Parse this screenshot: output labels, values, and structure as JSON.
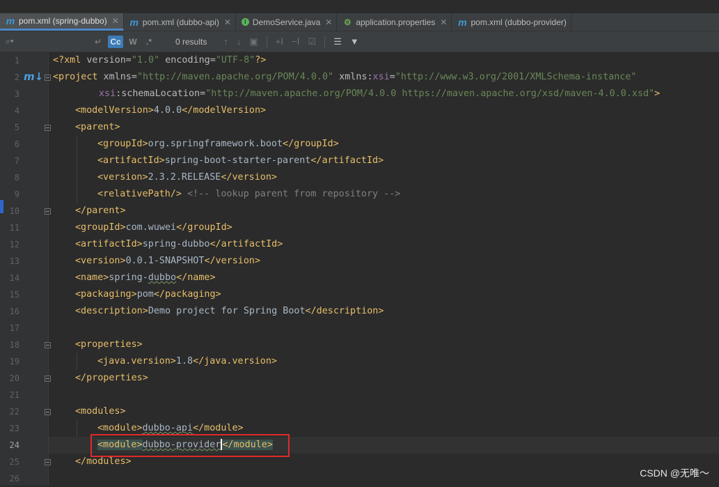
{
  "tabs": [
    {
      "label": "pom.xml (spring-dubbo)",
      "icon": "maven-icon",
      "active": true
    },
    {
      "label": "pom.xml (dubbo-api)",
      "icon": "maven-icon",
      "active": false
    },
    {
      "label": "DemoService.java",
      "icon": "java-interface-icon",
      "active": false
    },
    {
      "label": "application.properties",
      "icon": "properties-icon",
      "active": false
    },
    {
      "label": "pom.xml (dubbo-provider)",
      "icon": "maven-icon",
      "active": false
    }
  ],
  "search": {
    "placeholder": "",
    "match_case": "Cc",
    "words": "W",
    "regex": ".*",
    "results": "0 results"
  },
  "editor": {
    "line_numbers": [
      "1",
      "2",
      "3",
      "4",
      "5",
      "6",
      "7",
      "8",
      "9",
      "10",
      "11",
      "12",
      "13",
      "14",
      "15",
      "16",
      "17",
      "18",
      "19",
      "20",
      "21",
      "22",
      "23",
      "24",
      "25",
      "26"
    ],
    "current_line": "24"
  },
  "code": {
    "l1": {
      "decl_open": "<?xml ",
      "version_attr": "version=",
      "version_val": "\"1.0\"",
      "encoding_attr": " encoding=",
      "encoding_val": "\"UTF-8\"",
      "decl_close": "?>"
    },
    "l2": {
      "tag": "<project",
      "xmlns_attr": " xmlns=",
      "xmlns_val": "\"http://maven.apache.org/POM/4.0.0\"",
      "xsi_attr": " xmlns:",
      "xsi_ns": "xsi",
      "eq": "=",
      "xsi_val": "\"http://www.w3.org/2001/XMLSchema-instance\""
    },
    "l3": {
      "ns": "xsi",
      "attr": ":schemaLocation=",
      "val": "\"http://maven.apache.org/POM/4.0.0 https://maven.apache.org/xsd/maven-4.0.0.xsd\"",
      "close": ">"
    },
    "l4": {
      "open": "<modelVersion>",
      "text": "4.0.0",
      "close": "</modelVersion>"
    },
    "l5": {
      "open": "<parent>"
    },
    "l6": {
      "open": "<groupId>",
      "text": "org.springframework.boot",
      "close": "</groupId>"
    },
    "l7": {
      "open": "<artifactId>",
      "text": "spring-boot-starter-parent",
      "close": "</artifactId>"
    },
    "l8": {
      "open": "<version>",
      "text": "2.3.2.RELEASE",
      "close": "</version>"
    },
    "l9": {
      "open": "<relativePath/>",
      "comment": " <!-- lookup parent from repository -->"
    },
    "l10": {
      "close": "</parent>"
    },
    "l11": {
      "open": "<groupId>",
      "text": "com.wuwei",
      "close": "</groupId>"
    },
    "l12": {
      "open": "<artifactId>",
      "text": "spring-dubbo",
      "close": "</artifactId>"
    },
    "l13": {
      "open": "<version>",
      "text": "0.0.1-SNAPSHOT",
      "close": "</version>"
    },
    "l14": {
      "open": "<name>",
      "text_a": "spring-",
      "text_b": "dubbo",
      "close": "</name>"
    },
    "l15": {
      "open": "<packaging>",
      "text": "pom",
      "close": "</packaging>"
    },
    "l16": {
      "open": "<description>",
      "text": "Demo project for Spring Boot",
      "close": "</description>"
    },
    "l18": {
      "open": "<properties>"
    },
    "l19": {
      "open": "<java.version>",
      "text": "1.8",
      "close": "</java.version>"
    },
    "l20": {
      "close": "</properties>"
    },
    "l22": {
      "open": "<modules>"
    },
    "l23": {
      "open": "<module>",
      "text": "dubbo-api",
      "close": "</module>"
    },
    "l24": {
      "open": "<module>",
      "text": "dubbo-provider",
      "close": "</module>"
    },
    "l25": {
      "close": "</modules>"
    }
  },
  "watermark": "CSDN @无唯～"
}
